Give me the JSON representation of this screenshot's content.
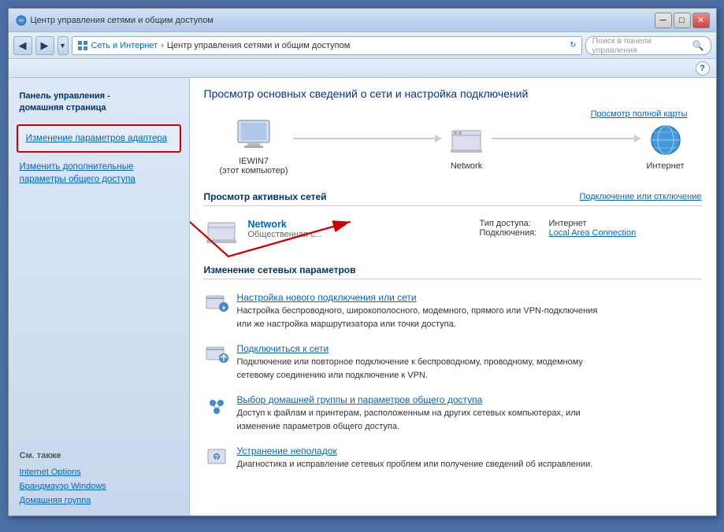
{
  "window": {
    "title": "Центр управления сетями и общим доступом",
    "min_btn": "─",
    "max_btn": "□",
    "close_btn": "✕"
  },
  "addressbar": {
    "back_arrow": "◀",
    "forward_arrow": "▶",
    "dropdown_arrow": "▼",
    "refresh_arrow": "↻",
    "breadcrumb_root_icon": "⊞",
    "breadcrumb_root": "Сеть и Интернет",
    "breadcrumb_sep": "›",
    "breadcrumb_current": "Центр управления сетями и общим доступом",
    "search_placeholder": "Поиск в панели управления",
    "search_icon": "🔍"
  },
  "help_icon": "?",
  "sidebar": {
    "section_title": "Панель управления -\nдомашняя страница",
    "highlighted_link": "Изменение параметров адаптера",
    "link2": "Изменить дополнительные параметры общего доступа",
    "also_title": "См. также",
    "also_links": [
      "Internet Options",
      "Брандмауэр Windows",
      "Домашняя группа"
    ]
  },
  "content": {
    "title": "Просмотр основных сведений о сети и настройка подключений",
    "view_full_map": "Просмотр полной карты",
    "map_items": [
      {
        "label": "IEWIN7\n(этот компьютер)",
        "type": "computer"
      },
      {
        "label": "Network",
        "type": "network"
      },
      {
        "label": "Интернет",
        "type": "internet"
      }
    ],
    "active_networks_title": "Просмотр активных сетей",
    "connect_disconnect": "Подключение или отключение",
    "network_name": "Network",
    "network_subtype": "Общественная с...",
    "access_type_label": "Тип доступа:",
    "access_type_value": "Интернет",
    "connections_label": "Подключения:",
    "connections_value": "Local Area Connection",
    "change_section_title": "Изменение сетевых параметров",
    "settings_items": [
      {
        "link": "Настройка нового подключения или сети",
        "desc": "Настройка беспроводного, широкополосного, модемного, прямого или VPN-подключения\nили же настройка маршрутизатора или точки доступа.",
        "icon_type": "setup"
      },
      {
        "link": "Подключиться к сети",
        "desc": "Подключение или повторное подключение к беспроводному, проводному, модемному\nсетевому соединению или подключение к VPN.",
        "icon_type": "connect"
      },
      {
        "link": "Выбор домашней группы и параметров общего доступа",
        "desc": "Доступ к файлам и принтерам, расположенным на других сетевых компьютерах, или\nизменение параметров общего доступа.",
        "icon_type": "homegroup"
      },
      {
        "link": "Устранение неполадок",
        "desc": "Диагностика и исправление сетевых проблем или получение сведений об исправлении.",
        "icon_type": "troubleshoot"
      }
    ]
  }
}
